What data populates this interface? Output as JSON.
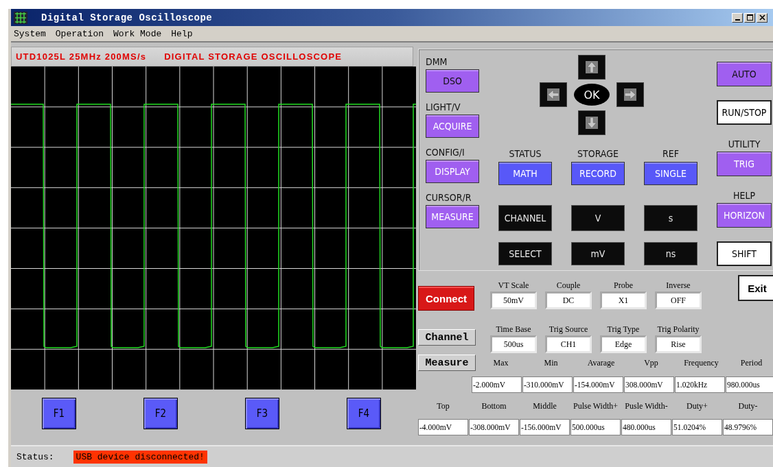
{
  "window": {
    "title": "Digital Storage Oscilloscope"
  },
  "menu": [
    "System",
    "Operation",
    "Work Mode",
    "Help"
  ],
  "scope": {
    "banner_model": "UTD1025L 25MHz 200MS/s",
    "banner_title": "DIGITAL STORAGE OSCILLOSCOPE",
    "soft_keys": [
      "F1",
      "F2",
      "F3",
      "F4"
    ]
  },
  "control_panel": {
    "left": [
      {
        "label": "DMM",
        "button": "DSO",
        "kind": "lilac"
      },
      {
        "label": "LIGHT/V",
        "button": "ACQUIRE",
        "kind": "purple"
      },
      {
        "label": "CONFIG/I",
        "button": "DISPLAY",
        "kind": "purple"
      },
      {
        "label": "CURSOR/R",
        "button": "MEASURE",
        "kind": "purple"
      }
    ],
    "nav_ok": "OK",
    "middle": [
      {
        "label": "STATUS",
        "buttons": [
          {
            "text": "MATH",
            "kind": "blue"
          },
          {
            "text": "CHANNEL",
            "kind": "black"
          },
          {
            "text": "SELECT",
            "kind": "black"
          }
        ]
      },
      {
        "label": "STORAGE",
        "buttons": [
          {
            "text": "RECORD",
            "kind": "blue"
          },
          {
            "text": "V",
            "kind": "black"
          },
          {
            "text": "mV",
            "kind": "black"
          }
        ]
      },
      {
        "label": "REF",
        "buttons": [
          {
            "text": "SINGLE",
            "kind": "blue"
          },
          {
            "text": "s",
            "kind": "black"
          },
          {
            "text": "ns",
            "kind": "black"
          }
        ]
      }
    ],
    "right": [
      {
        "button": "AUTO",
        "kind": "lilac"
      },
      {
        "button": "RUN/STOP",
        "kind": "white"
      },
      {
        "label": "UTILITY",
        "button": "TRIG",
        "kind": "purple"
      },
      {
        "label": "HELP",
        "button": "HORIZON",
        "kind": "purple"
      },
      {
        "button": "SHIFT",
        "kind": "white"
      }
    ]
  },
  "connect_button": "Connect",
  "exit_button": "Exit",
  "channel_button": "Channel",
  "measure_button": "Measure",
  "channel_fields": [
    {
      "label": "VT Scale",
      "value": "50mV"
    },
    {
      "label": "Couple",
      "value": "DC"
    },
    {
      "label": "Probe",
      "value": "X1"
    },
    {
      "label": "Inverse",
      "value": "OFF"
    },
    {
      "label": "Time Base",
      "value": "500us"
    },
    {
      "label": "Trig Source",
      "value": "CH1"
    },
    {
      "label": "Trig Type",
      "value": "Edge"
    },
    {
      "label": "Trig Polarity",
      "value": "Rise"
    }
  ],
  "measurements_1": [
    {
      "label": "Max",
      "value": "-2.000mV"
    },
    {
      "label": "Min",
      "value": "-310.000mV"
    },
    {
      "label": "Avarage",
      "value": "-154.000mV"
    },
    {
      "label": "Vpp",
      "value": "308.000mV"
    },
    {
      "label": "Frequency",
      "value": "1.020kHz"
    },
    {
      "label": "Period",
      "value": "980.000us"
    }
  ],
  "measurements_2": [
    {
      "label": "Top",
      "value": "-4.000mV"
    },
    {
      "label": "Bottom",
      "value": "-308.000mV"
    },
    {
      "label": "Middle",
      "value": "-156.000mV"
    },
    {
      "label": "Pulse Width+",
      "value": "500.000us"
    },
    {
      "label": "Pusle Width-",
      "value": "480.000us"
    },
    {
      "label": "Duty+",
      "value": "51.0204%"
    },
    {
      "label": "Duty-",
      "value": "48.9796%"
    }
  ],
  "status_bar": {
    "label": "Status:",
    "message": "USB device disconnected!"
  }
}
